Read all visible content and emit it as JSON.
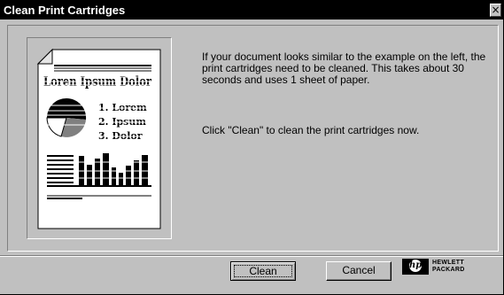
{
  "window": {
    "title": "Clean Print Cartridges",
    "close_glyph": "×"
  },
  "illustration": {
    "heading": "Loren Ipsum Dolor",
    "legend": [
      "1. Lorem",
      "2. Ipsum",
      "3. Dolor"
    ]
  },
  "message": {
    "paragraph1": "If your document looks similar to the example on the left, the print cartridges need to be cleaned.  This takes about 30 seconds and uses 1 sheet of paper.",
    "paragraph2": "Click \"Clean\" to clean the print cartridges now."
  },
  "buttons": {
    "clean_label": "Clean",
    "cancel_label": "Cancel"
  },
  "brand": {
    "mark": "hp",
    "line1": "HEWLETT",
    "line2": "PACKARD"
  },
  "colors": {
    "titlebar": "#000000",
    "window_bg": "#c0c0c0"
  }
}
